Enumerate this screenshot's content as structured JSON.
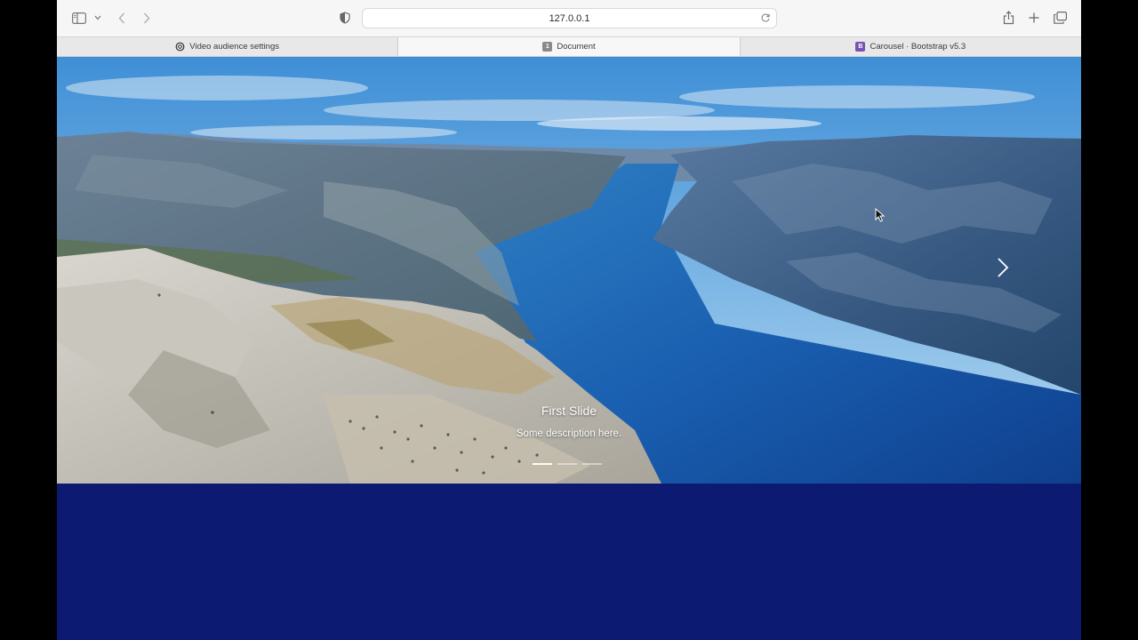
{
  "browser": {
    "address": "127.0.0.1",
    "tabs": [
      {
        "label": "Video audience settings",
        "favicon": "openai-icon",
        "active": false
      },
      {
        "label": "Document",
        "favicon": "1",
        "active": true
      },
      {
        "label": "Carousel · Bootstrap v5.3",
        "favicon": "B",
        "active": false
      }
    ]
  },
  "carousel": {
    "caption_title": "First Slide",
    "caption_text": "Some description here.",
    "active_index": 0,
    "slide_count": 3
  },
  "colors": {
    "page_background": "#0d1a72",
    "bootstrap_purple": "#7952b3"
  }
}
